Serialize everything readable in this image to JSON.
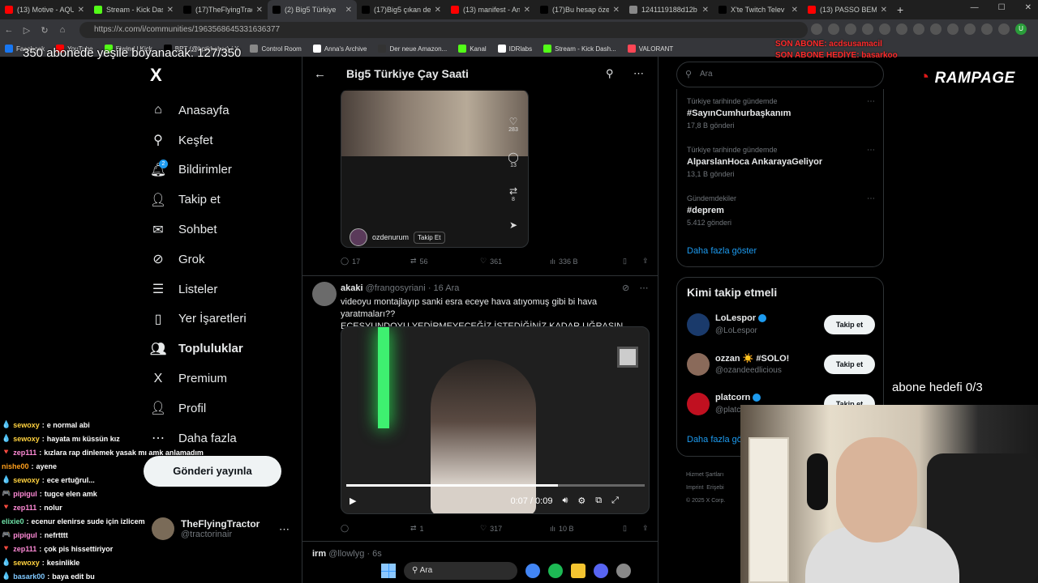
{
  "browser": {
    "tabs": [
      {
        "title": "(13) Motive - AQU",
        "color": "#ff0000"
      },
      {
        "title": "Stream - Kick Dash",
        "color": "#53fc18"
      },
      {
        "title": "(17)TheFlyingTract",
        "color": "#000000"
      },
      {
        "title": "(2) Big5 Türkiye",
        "color": "#000000"
      },
      {
        "title": "(17)Big5 çıkan de",
        "color": "#000000"
      },
      {
        "title": "(13) manifest - An",
        "color": "#ff0000"
      },
      {
        "title": "(17)Bu hesap özel",
        "color": "#000000"
      },
      {
        "title": "1241119188d12b",
        "color": "#888888"
      },
      {
        "title": "X'te Twitch Telev",
        "color": "#000000"
      },
      {
        "title": "(13) PASSO BEM S",
        "color": "#ff0000"
      }
    ],
    "url": "https://x.com/i/communities/1963568645331636377",
    "bookmarks": [
      "Facebook",
      "YouTube",
      "Elwind | Kick",
      "BPT (@bptkhaber) / X",
      "Control Room",
      "Anna's Archive",
      "Der neue Amazon...",
      "Kanal",
      "IDRlabs",
      "Stream - Kick Dash...",
      "VALORANT"
    ]
  },
  "overlay": {
    "top_text": "350 abonede yeşile boyanacak: 127/350",
    "sub_line1": "SON ABONE: acdsusamacil",
    "sub_line2": "SON ABONE HEDİYE: basarkoo",
    "brand": "RAMPAGE",
    "goal": "abone hedefi 0/3"
  },
  "sidebar": {
    "logo": "X",
    "items": [
      {
        "label": "Anasayfa",
        "icon": "home-icon",
        "glyph": "⌂"
      },
      {
        "label": "Keşfet",
        "icon": "search-icon",
        "glyph": "⚲"
      },
      {
        "label": "Bildirimler",
        "icon": "bell-icon",
        "glyph": "🔔︎"
      },
      {
        "label": "Takip et",
        "icon": "add-person-icon",
        "glyph": "👤︎"
      },
      {
        "label": "Sohbet",
        "icon": "mail-icon",
        "glyph": "✉"
      },
      {
        "label": "Grok",
        "icon": "grok-icon",
        "glyph": "⊘"
      },
      {
        "label": "Listeler",
        "icon": "list-icon",
        "glyph": "☰"
      },
      {
        "label": "Yer İşaretleri",
        "icon": "bookmark-icon",
        "glyph": "▯"
      },
      {
        "label": "Topluluklar",
        "icon": "communities-icon",
        "glyph": "👥︎"
      },
      {
        "label": "Premium",
        "icon": "premium-x-icon",
        "glyph": "X"
      },
      {
        "label": "Profil",
        "icon": "profile-icon",
        "glyph": "👤︎"
      },
      {
        "label": "Daha fazla",
        "icon": "more-circle-icon",
        "glyph": "⋯"
      }
    ],
    "notification_badge": "2",
    "post_button": "Gönderi yayınla",
    "account": {
      "name": "TheFlyingTractor",
      "handle": "@tractorinair",
      "more": "⋯"
    }
  },
  "main": {
    "header_title": "Big5 Türkiye Çay Saati",
    "post1": {
      "media_user": "ozdenurum",
      "media_follow": "Takip Et",
      "media_likes": "283",
      "media_comments": "13",
      "media_reposts": "8",
      "replies": "17",
      "reposts": "56",
      "likes": "361",
      "views": "336 B"
    },
    "post2": {
      "name": "akaki",
      "handle": "@frangosyriani",
      "date": "16 Ara",
      "text_line1": "videoyu montajlayıp sanki esra eceye hava atıyomuş gibi bi hava yaratmaları??",
      "text_line2": "ECESYUNDOYU YEDİRMEYECEĞİZ İSTEDİĞİNİZ KADAR UĞRAŞIN",
      "video_time": "0:07 / 0:09",
      "video_progress": 0.71,
      "replies": "",
      "reposts": "1",
      "likes": "317",
      "views": "10 B"
    },
    "post3": {
      "name": "irm",
      "handle": "@llowlyg",
      "date": "6s"
    }
  },
  "right": {
    "search_placeholder": "Ara",
    "trends": [
      {
        "context": "Türkiye tarihinde gündemde",
        "name": "#SayınCumhurbaşkanım",
        "count": "17,8 B gönderi"
      },
      {
        "context": "Türkiye tarihinde gündemde",
        "name": "AlparslanHoca AnkarayaGeliyor",
        "count": "13,1 B gönderi"
      },
      {
        "context": "Gündemdekiler",
        "name": "#deprem",
        "count": "5.412 gönderi"
      }
    ],
    "show_more": "Daha fazla göster",
    "wtf_title": "Kimi takip etmeli",
    "who_to_follow": [
      {
        "name": "LoLespor",
        "handle": "@LoLespor",
        "button": "Takip et",
        "color": "#1a3a6b"
      },
      {
        "name": "ozzan ☀️ #SOLO!",
        "handle": "@ozandeedlicious",
        "button": "Takip et",
        "color": "#8a6a5a"
      },
      {
        "name": "platcorn",
        "handle": "@platcorn",
        "button": "Takip et",
        "color": "#c01020"
      }
    ],
    "wtf_more": "Daha fazla gö",
    "footer": [
      "Hizmet Şartları",
      "Imprint",
      "Erişebi",
      "© 2025 X Corp."
    ]
  },
  "chat": [
    {
      "user": "sewoxy",
      "msg": "e normal abi",
      "color": "#ffd23f",
      "icon": "💧"
    },
    {
      "user": "sewoxy",
      "msg": "hayata mı küssün kız",
      "color": "#ffd23f",
      "icon": "💧"
    },
    {
      "user": "zep111",
      "msg": "kızlara rap dinlemek yasak mı amk anlamadım",
      "color": "#ff8ad6",
      "icon": "🔻"
    },
    {
      "user": "nishe00",
      "msg": "ayene",
      "color": "#ff9f1c",
      "icon": ""
    },
    {
      "user": "sewoxy",
      "msg": "ece ertuğrul...",
      "color": "#ffd23f",
      "icon": "💧"
    },
    {
      "user": "pipigul",
      "msg": "tugce elen amk",
      "color": "#ff8ad6",
      "icon": "🎮"
    },
    {
      "user": "zep111",
      "msg": "nolur",
      "color": "#ff8ad6",
      "icon": "🔻"
    },
    {
      "user": "elixie0",
      "msg": "ecenur elenirse sude için izlicem",
      "color": "#6fe3a8",
      "icon": ""
    },
    {
      "user": "pipigul",
      "msg": "nefrtttt",
      "color": "#ff8ad6",
      "icon": "🎮"
    },
    {
      "user": "zep111",
      "msg": "çok pis hissettiriyor",
      "color": "#ff8ad6",
      "icon": "🔻"
    },
    {
      "user": "sewoxy",
      "msg": "kesinlikle",
      "color": "#ffd23f",
      "icon": "💧"
    },
    {
      "user": "basark00",
      "msg": "baya edit bu",
      "color": "#7fc8ff",
      "icon": "💧"
    }
  ],
  "taskbar": {
    "search": "Ara"
  }
}
